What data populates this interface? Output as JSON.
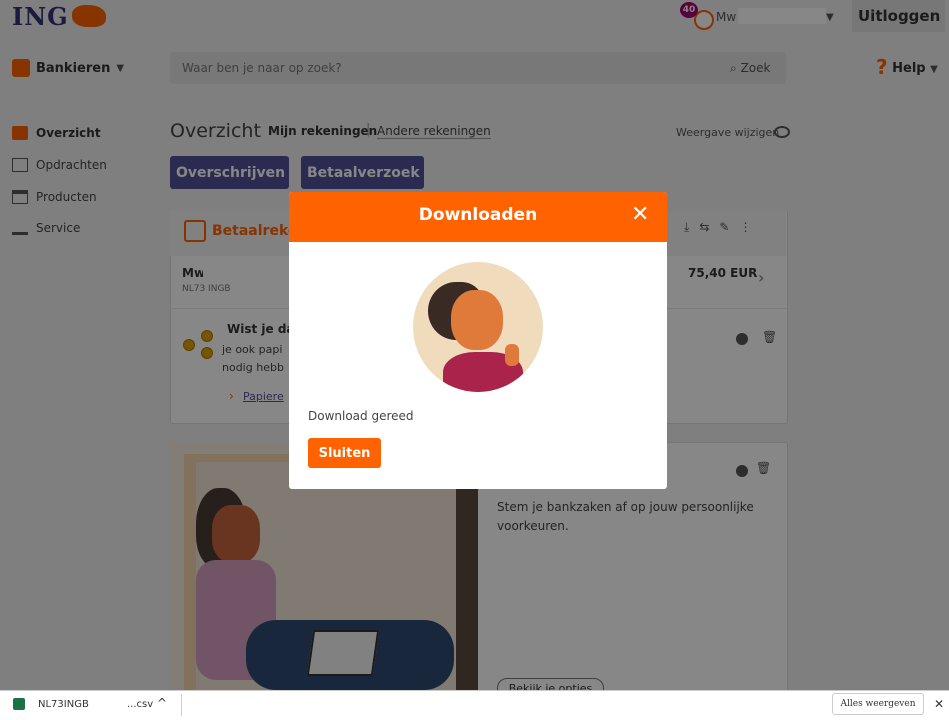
{
  "header": {
    "logo": "ING",
    "notification_count": "40",
    "user_name": "Mw",
    "logout_label": "Uitloggen"
  },
  "nav": {
    "bank_menu": "Bankieren",
    "search_placeholder": "Waar ben je naar op zoek?",
    "search_button": "Zoek",
    "help": "Help"
  },
  "sidebar": {
    "items": [
      {
        "label": "Overzicht",
        "icon": "briefcase-icon",
        "active": true
      },
      {
        "label": "Opdrachten",
        "icon": "calendar-icon",
        "active": false
      },
      {
        "label": "Producten",
        "icon": "bank-icon",
        "active": false
      },
      {
        "label": "Service",
        "icon": "person-desk-icon",
        "active": false
      }
    ]
  },
  "main": {
    "title": "Overzicht",
    "tab_mine": "Mijn rekeningen",
    "tab_sep": "|",
    "tab_other": "Andere rekeningen",
    "view_change": "Weergave wijzigen",
    "btn_transfer": "Overschrijven",
    "btn_request": "Betaalverzoek",
    "account_card": {
      "title": "Betaalreke",
      "name": "Mw",
      "iban": "NL73 INGB",
      "amount": "75,40 EUR"
    },
    "tip": {
      "title": "Wist je dat",
      "line1": "je ook papi",
      "line2": "nodig hebb",
      "link": "Papiere"
    },
    "promo": {
      "line1": "Stem je bankzaken af op jouw persoonlijke",
      "line2": "voorkeuren.",
      "button": "Bekijk je opties"
    }
  },
  "modal": {
    "title": "Downloaden",
    "message": "Download gereed",
    "close_button": "Sluiten"
  },
  "download_bar": {
    "file_name": "NL73INGB",
    "file_ext": "...csv",
    "show_all": "Alles weergeven"
  },
  "colors": {
    "brand_orange": "#ff6200",
    "brand_purple": "#525199",
    "ing_blue": "#33337a"
  }
}
